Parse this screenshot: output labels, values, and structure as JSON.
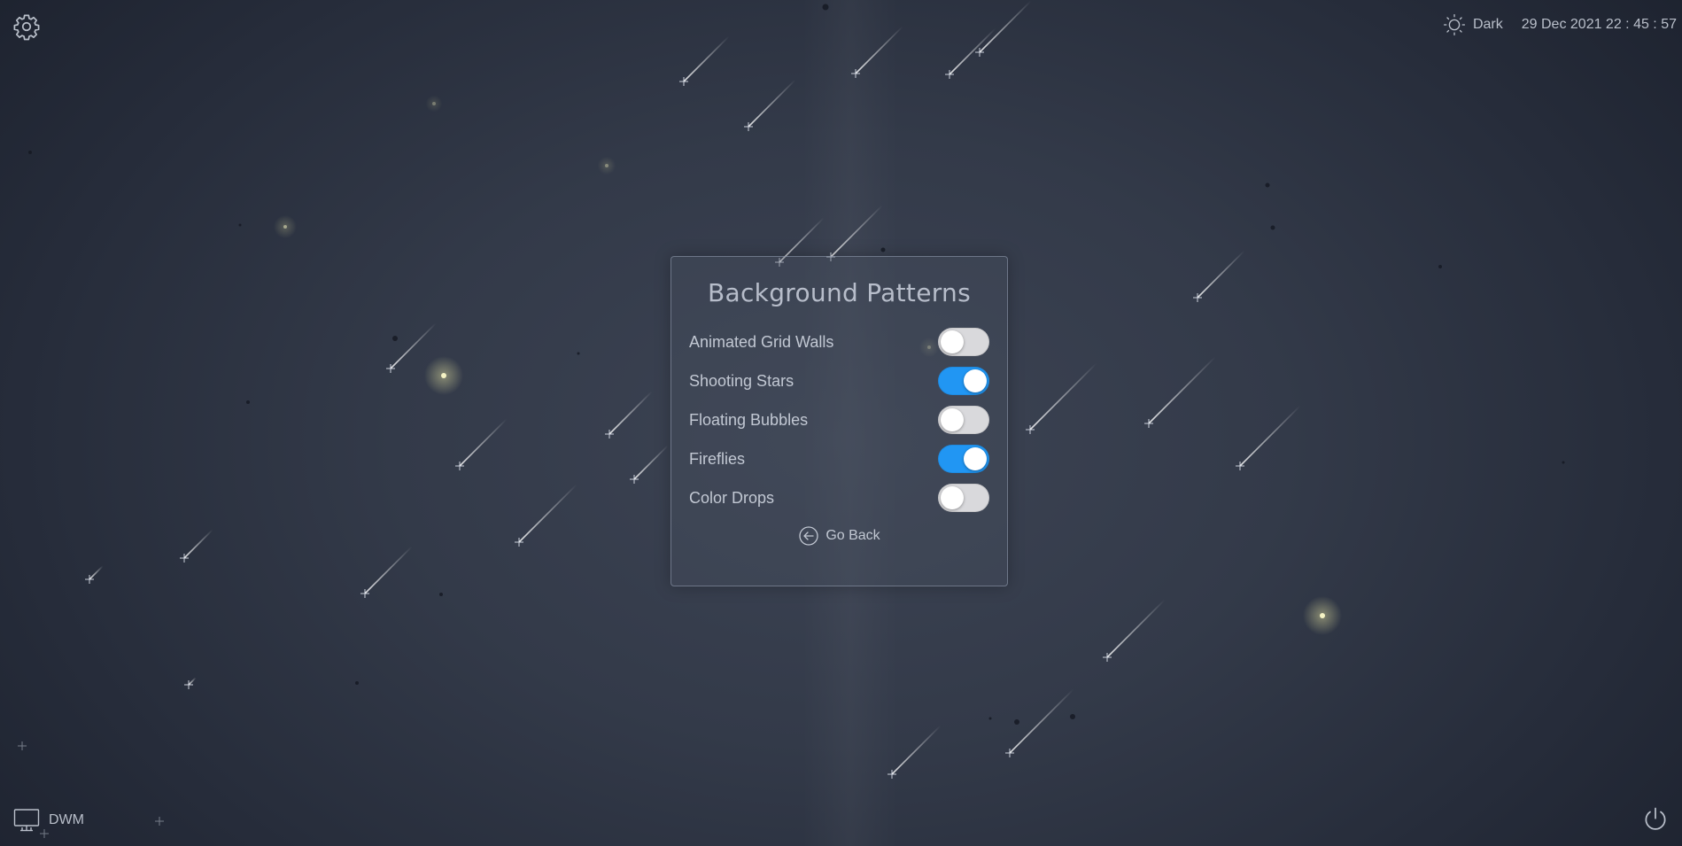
{
  "topbar": {
    "settings_icon": "gear-icon",
    "theme_icon": "sun-icon",
    "theme_label": "Dark",
    "datetime": "29 Dec 2021 22 : 45 : 57"
  },
  "panel": {
    "title": "Background Patterns",
    "options": [
      {
        "label": "Animated Grid Walls",
        "enabled": false
      },
      {
        "label": "Shooting Stars",
        "enabled": true
      },
      {
        "label": "Floating Bubbles",
        "enabled": false
      },
      {
        "label": "Fireflies",
        "enabled": true
      },
      {
        "label": "Color Drops",
        "enabled": false
      }
    ],
    "back_icon": "arrow-left-circle-icon",
    "back_label": "Go Back"
  },
  "footer": {
    "wm_icon": "monitor-icon",
    "wm_label": "DWM",
    "power_icon": "power-icon"
  },
  "colors": {
    "toggle_on": "#2196f3",
    "toggle_off": "#d9d9dc",
    "firefly": "#f5f3c4"
  }
}
